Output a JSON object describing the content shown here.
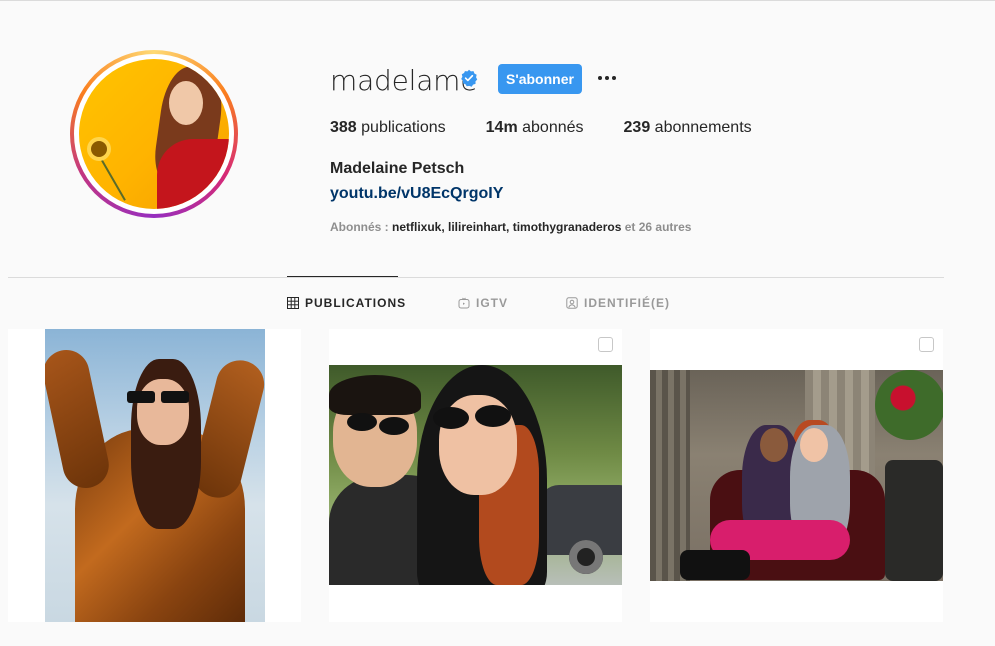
{
  "profile": {
    "username": "madelame",
    "verified_icon": "verified-badge-icon",
    "follow_label": "S'abonner",
    "more_icon": "more-options-icon",
    "stats": [
      {
        "value": "388",
        "label": " publications"
      },
      {
        "value": "14m",
        "label": " abonnés"
      },
      {
        "value": "239",
        "label": " abonnements"
      }
    ],
    "full_name": "Madelaine Petsch",
    "link": "youtu.be/vU8EcQrgoIY",
    "followed_by": {
      "prefix": "Abonnés : ",
      "names": "netflixuk, lilireinhart, timothygranaderos",
      "suffix": " et 26 autres"
    }
  },
  "tabs": [
    {
      "label": "PUBLICATIONS",
      "icon": "grid-icon",
      "active": true
    },
    {
      "label": "IGTV",
      "icon": "igtv-icon",
      "active": false
    },
    {
      "label": "IDENTIFIÉ(E)",
      "icon": "tagged-icon",
      "active": false
    }
  ],
  "colors": {
    "accent": "#3897f0",
    "link": "#003569",
    "muted": "#8e8e8e",
    "background": "#fafafa"
  }
}
